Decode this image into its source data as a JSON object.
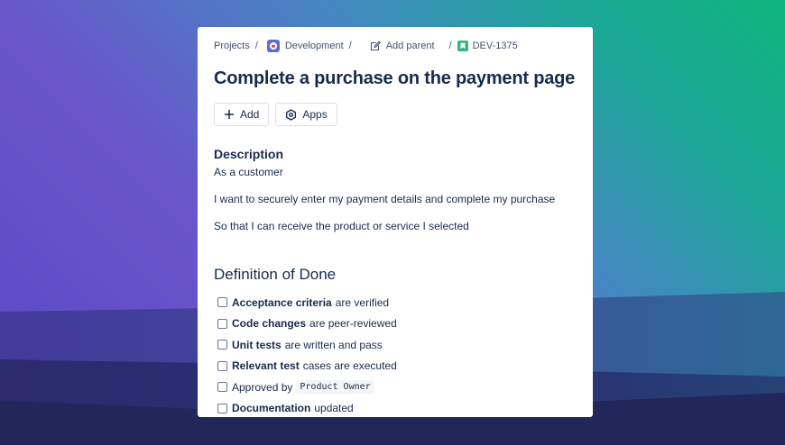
{
  "breadcrumb": {
    "projects": "Projects",
    "project_name": "Development",
    "add_parent": "Add parent",
    "issue_key": "DEV-1375",
    "separator": "/"
  },
  "issue": {
    "title": "Complete a purchase on the payment page"
  },
  "actions": {
    "add_label": "Add",
    "apps_label": "Apps"
  },
  "description": {
    "heading": "Description",
    "lines": [
      "As a customer",
      "I want to securely enter my payment details and complete my purchase",
      "So that I can receive the product or service I selected"
    ]
  },
  "definition_of_done": {
    "heading": "Definition of Done",
    "items": [
      {
        "bold": "Acceptance criteria",
        "rest": "are verified",
        "checked": false
      },
      {
        "bold": "Code changes",
        "rest": "are peer-reviewed",
        "checked": false
      },
      {
        "bold": "Unit tests",
        "rest": "are written and pass",
        "checked": false
      },
      {
        "bold": "Relevant test",
        "rest": "cases are executed",
        "checked": false
      },
      {
        "prefix": "Approved by",
        "code": "Product Owner",
        "checked": false
      },
      {
        "bold": "Documentation",
        "rest": "updated",
        "checked": false
      }
    ]
  },
  "icons": {
    "project": "project-avatar-icon",
    "parent": "pencil-edit-icon",
    "issue_type": "story-bookmark-icon",
    "add": "plus-icon",
    "apps": "hexagon-apps-icon"
  },
  "colors": {
    "story_green": "#36b37e",
    "project_blue": "#5b6bdc",
    "text": "#172b4d"
  }
}
